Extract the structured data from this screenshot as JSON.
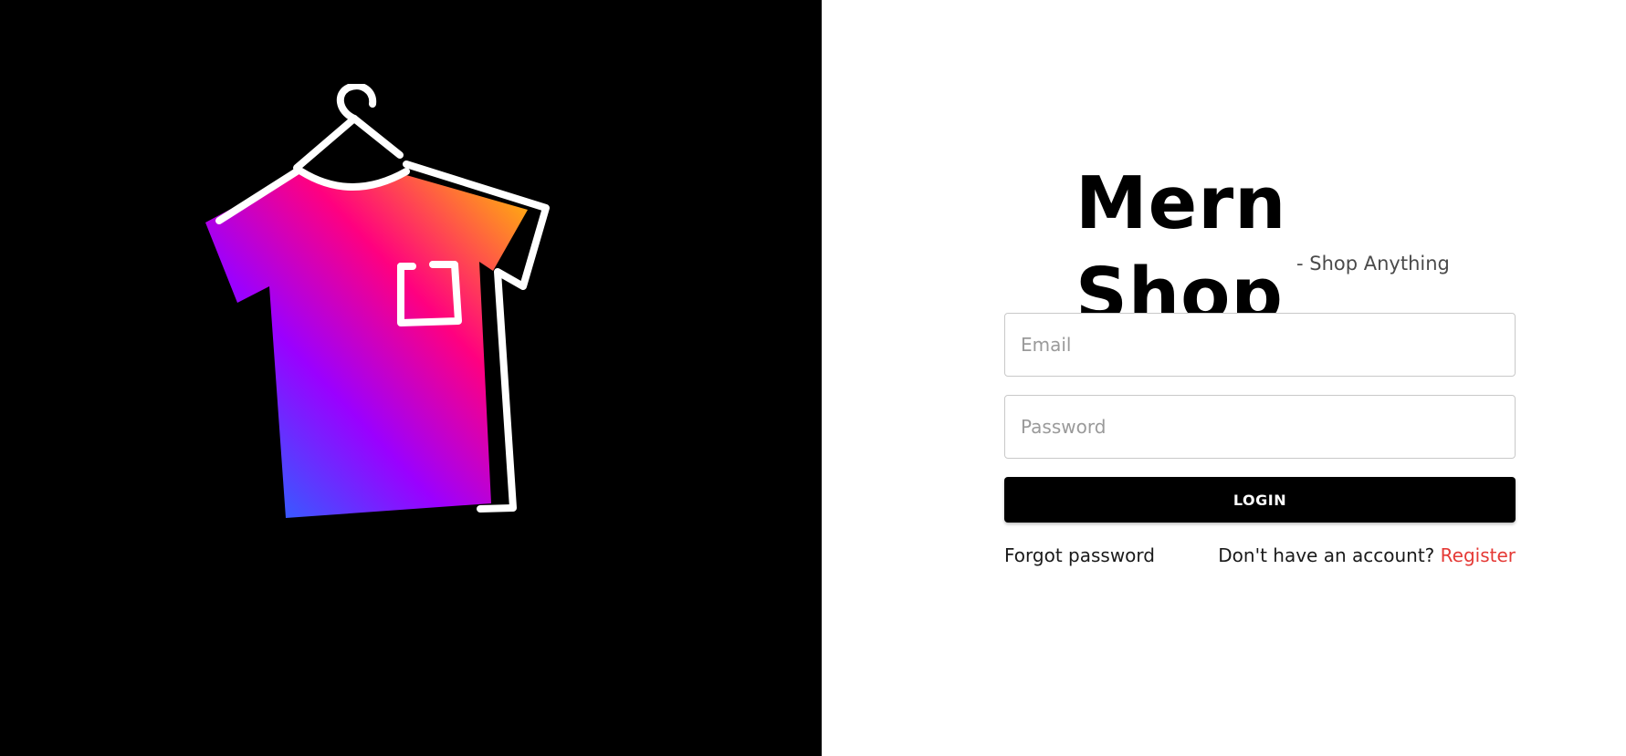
{
  "brand": {
    "title": "Mern Shop",
    "tagline": "- Shop Anything",
    "logo_icon": "tshirt-hanger-icon"
  },
  "form": {
    "email_placeholder": "Email",
    "email_value": "",
    "password_placeholder": "Password",
    "password_value": "",
    "login_label": "LOGIN"
  },
  "links": {
    "forgot_password": "Forgot password",
    "no_account_text": "Don't have an account?",
    "register": "Register"
  },
  "colors": {
    "left_background": "#000000",
    "right_background": "#ffffff",
    "button_background": "#000000",
    "register_link": "#e53935",
    "gradient": [
      "#0a84ff",
      "#9b00ff",
      "#ff0080",
      "#ffc300"
    ]
  }
}
